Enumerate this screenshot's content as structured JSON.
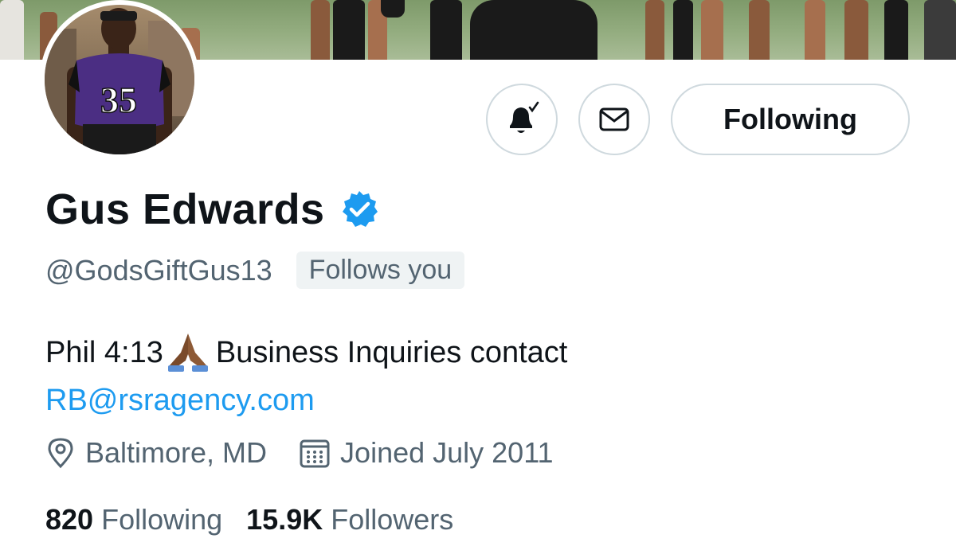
{
  "profile": {
    "name": "Gus Edwards",
    "handle": "@GodsGiftGus13",
    "follows_you": "Follows you",
    "jersey_number": "35",
    "bio_text": "Phil 4:13",
    "bio_text_2": "Business Inquiries contact",
    "bio_link": "RB@rsragency.com",
    "location": "Baltimore, MD",
    "joined": "Joined July 2011",
    "following_count": "820",
    "following_label": "Following",
    "followers_count": "15.9K",
    "followers_label": "Followers"
  },
  "actions": {
    "notifications_icon": "bell-subscribed-icon",
    "message_icon": "envelope-icon",
    "follow_label": "Following"
  },
  "colors": {
    "text": "#0f1419",
    "secondary": "#536471",
    "link": "#1d9bf0",
    "verified": "#1d9bf0",
    "border": "#cfd9de",
    "jersey": "#4b2e83"
  }
}
